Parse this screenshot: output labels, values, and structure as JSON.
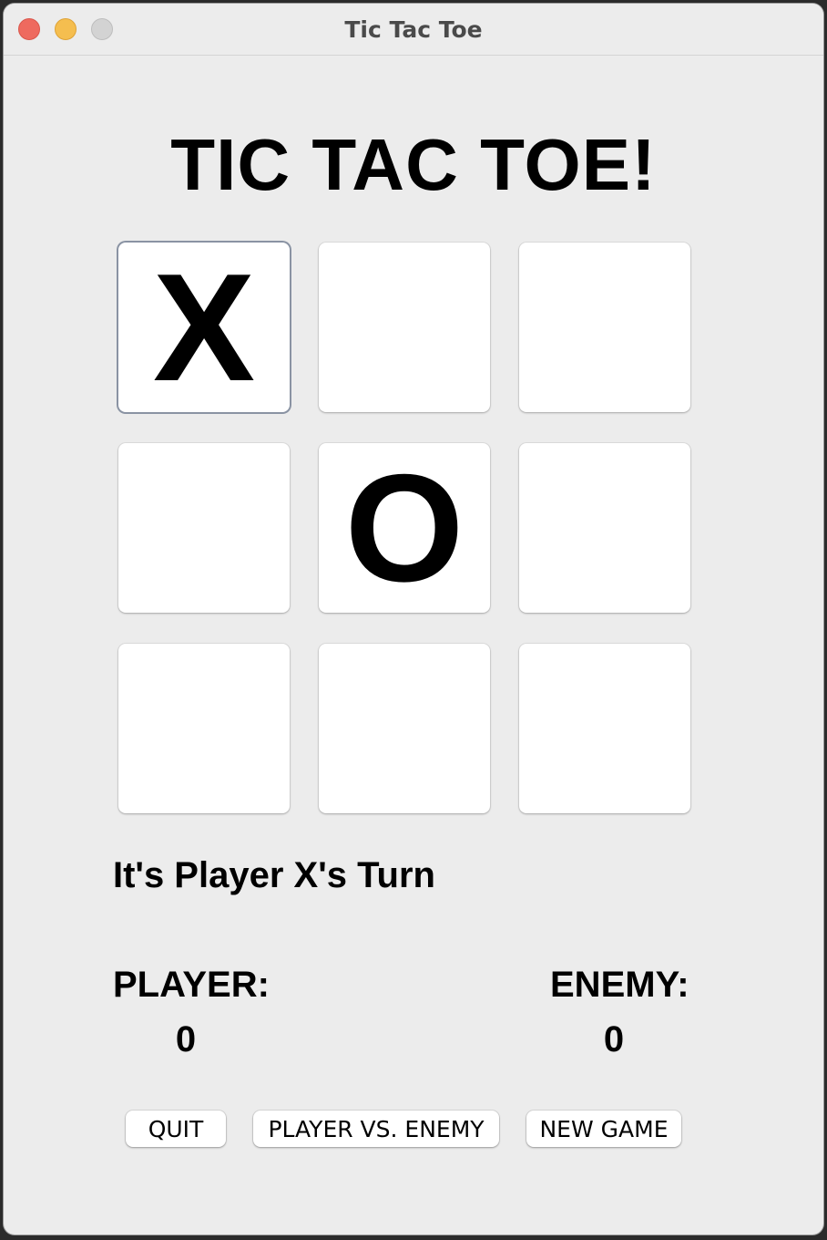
{
  "window": {
    "title": "Tic Tac Toe"
  },
  "game": {
    "heading": "TIC TAC TOE!",
    "board": [
      [
        "X",
        "",
        ""
      ],
      [
        "",
        "O",
        ""
      ],
      [
        "",
        "",
        ""
      ]
    ],
    "status": "It's Player X's Turn"
  },
  "scores": {
    "player_label": "PLAYER:",
    "player_score": "0",
    "enemy_label": "ENEMY:",
    "enemy_score": "0"
  },
  "buttons": {
    "quit": "QUIT",
    "mode": "PLAYER VS. ENEMY",
    "new_game": "NEW GAME"
  },
  "colors": {
    "window_bg": "#ececec",
    "cell_bg": "#ffffff",
    "focus_ring": "#8a93a3",
    "close": "#ee6a5f",
    "minimize": "#f5be4f",
    "maximize": "#d3d3d3"
  }
}
